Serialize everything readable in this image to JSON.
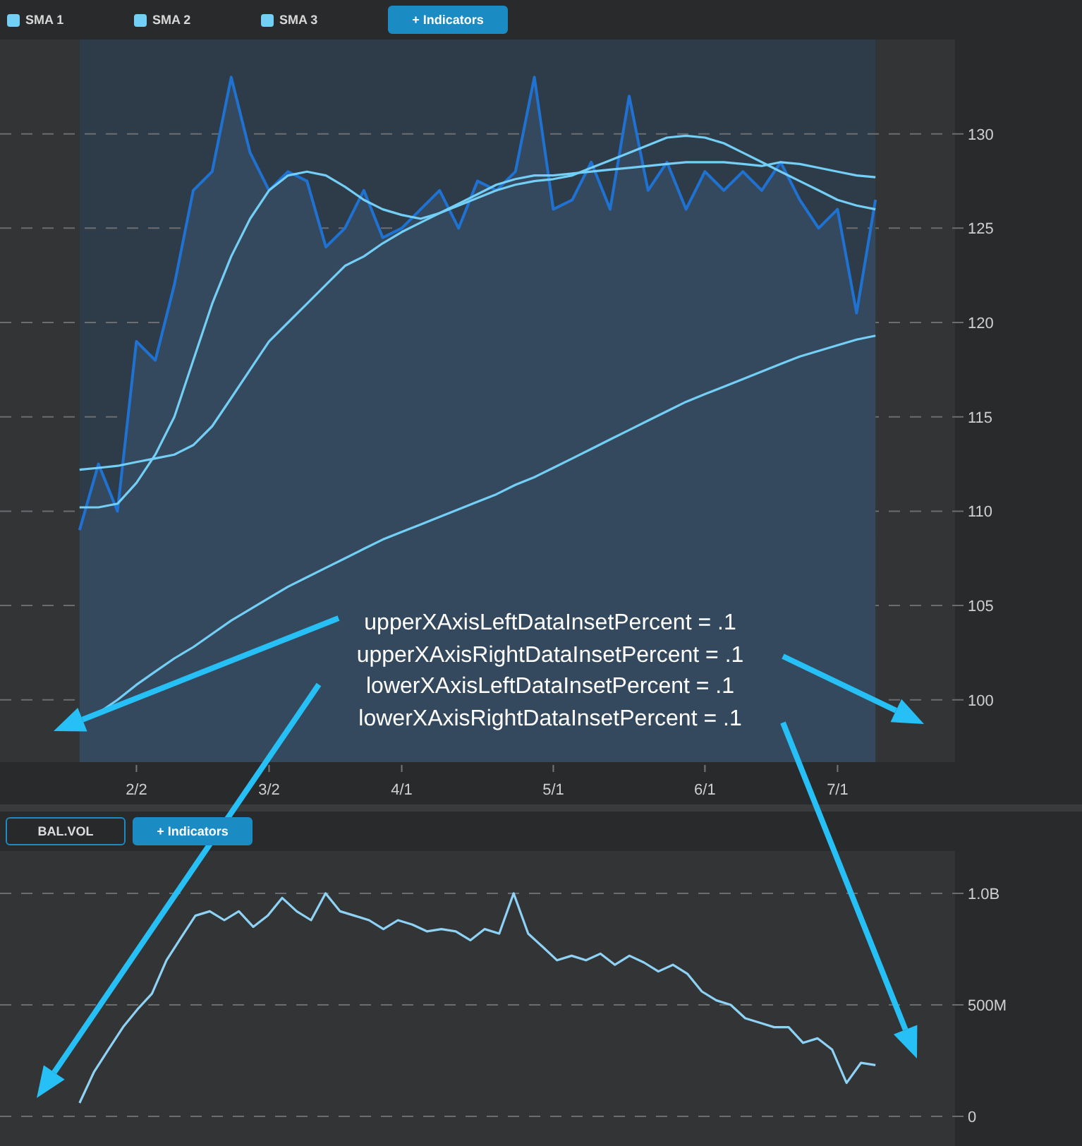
{
  "upper_chart": {
    "chart_data": {
      "type": "line",
      "categories": [
        null,
        null,
        null,
        "2/2",
        null,
        null,
        null,
        null,
        null,
        null,
        "3/2",
        null,
        null,
        null,
        null,
        null,
        null,
        "4/1",
        null,
        null,
        null,
        null,
        null,
        null,
        null,
        "5/1",
        null,
        null,
        null,
        null,
        null,
        null,
        null,
        "6/1",
        null,
        null,
        null,
        null,
        null,
        null,
        "7/1",
        null,
        null
      ],
      "series": [
        {
          "type": "area",
          "color": "#1f72d2",
          "values": [
            109,
            112.5,
            110,
            119,
            118,
            122,
            127,
            128,
            133,
            129,
            127,
            128,
            127.5,
            124,
            125,
            127,
            124.5,
            125,
            126,
            127,
            125,
            127.5,
            127,
            128,
            133,
            126,
            126.5,
            128.5,
            126,
            132,
            127,
            128.5,
            126,
            128,
            127,
            128,
            127,
            128.5,
            126.5,
            125,
            126,
            120.5,
            126.5
          ]
        },
        {
          "type": "line",
          "name": "SMA 1",
          "color": "#74cff6",
          "values": [
            110.2,
            110.2,
            110.4,
            111.5,
            113,
            115,
            118,
            121,
            123.5,
            125.5,
            127,
            127.8,
            128,
            127.8,
            127.2,
            126.5,
            126,
            125.7,
            125.5,
            125.8,
            126.3,
            126.8,
            127.3,
            127.6,
            127.8,
            127.8,
            127.9,
            128,
            128.1,
            128.2,
            128.3,
            128.4,
            128.5,
            128.5,
            128.5,
            128.4,
            128.3,
            128.5,
            128.4,
            128.2,
            128,
            127.8,
            127.7
          ]
        },
        {
          "type": "line",
          "name": "SMA 2",
          "color": "#74cff6",
          "values": [
            112.2,
            112.3,
            112.4,
            112.6,
            112.8,
            113,
            113.5,
            114.5,
            116,
            117.5,
            119,
            120,
            121,
            122,
            123,
            123.5,
            124.2,
            124.8,
            125.3,
            125.8,
            126.2,
            126.6,
            127,
            127.3,
            127.5,
            127.6,
            127.8,
            128.2,
            128.6,
            129,
            129.4,
            129.8,
            129.9,
            129.8,
            129.5,
            129,
            128.5,
            128,
            127.5,
            127,
            126.5,
            126.2,
            126
          ]
        },
        {
          "type": "line",
          "name": "SMA 3",
          "color": "#74cff6",
          "values": [
            null,
            99.3,
            100,
            100.8,
            101.5,
            102.2,
            102.8,
            103.5,
            104.2,
            104.8,
            105.4,
            106,
            106.5,
            107,
            107.5,
            108,
            108.5,
            108.9,
            109.3,
            109.7,
            110.1,
            110.5,
            110.9,
            111.4,
            111.8,
            112.3,
            112.8,
            113.3,
            113.8,
            114.3,
            114.8,
            115.3,
            115.8,
            116.2,
            116.6,
            117,
            117.4,
            117.8,
            118.2,
            118.5,
            118.8,
            119.1,
            119.3
          ]
        }
      ],
      "grid": true,
      "ylim": [
        96.7,
        135
      ],
      "yticks": [
        100,
        105,
        110,
        115,
        120,
        125,
        130
      ]
    }
  },
  "indicators_button": "+ Indicators",
  "lower_toolbar": {
    "study_button": "BAL.VOL",
    "indicators_button": "+ Indicators"
  },
  "lower_chart": {
    "chart_data": {
      "type": "line",
      "categories": [
        null,
        null,
        null,
        null,
        null,
        null,
        null,
        null,
        null,
        null,
        null,
        null,
        null,
        null,
        null,
        null,
        null,
        null,
        null,
        null,
        null,
        null,
        null,
        null,
        null,
        null,
        null,
        null,
        null,
        null,
        null,
        null,
        null,
        null,
        null,
        null,
        null,
        null,
        null,
        null,
        null,
        null,
        null,
        null,
        null,
        null,
        null,
        null,
        null,
        null,
        null,
        null,
        null,
        null,
        null,
        null
      ],
      "series": [
        {
          "type": "line",
          "color": "#8ed3f6",
          "values": [
            60000000,
            200000000,
            300000000,
            400000000,
            480000000,
            550000000,
            700000000,
            800000000,
            900000000,
            920000000,
            880000000,
            920000000,
            850000000,
            900000000,
            980000000,
            920000000,
            880000000,
            1000000000,
            920000000,
            900000000,
            880000000,
            840000000,
            880000000,
            860000000,
            830000000,
            840000000,
            830000000,
            790000000,
            840000000,
            820000000,
            1000000000,
            820000000,
            760000000,
            700000000,
            720000000,
            700000000,
            730000000,
            680000000,
            720000000,
            690000000,
            650000000,
            680000000,
            640000000,
            560000000,
            520000000,
            500000000,
            440000000,
            420000000,
            400000000,
            400000000,
            330000000,
            350000000,
            300000000,
            150000000,
            240000000,
            230000000
          ]
        }
      ],
      "grid": true,
      "ylim": [
        -133000000,
        1190000000
      ],
      "yticks": [
        {
          "value": 0,
          "label": "0"
        },
        {
          "value": 500000000,
          "label": "500M"
        },
        {
          "value": 1000000000,
          "label": "1.0B"
        }
      ]
    }
  },
  "callout": {
    "lines": [
      "upperXAxisLeftDataInsetPercent = .1",
      "upperXAxisRightDataInsetPercent = .1",
      "lowerXAxisLeftDataInsetPercent = .1",
      "lowerXAxisRightDataInsetPercent = .1"
    ]
  }
}
